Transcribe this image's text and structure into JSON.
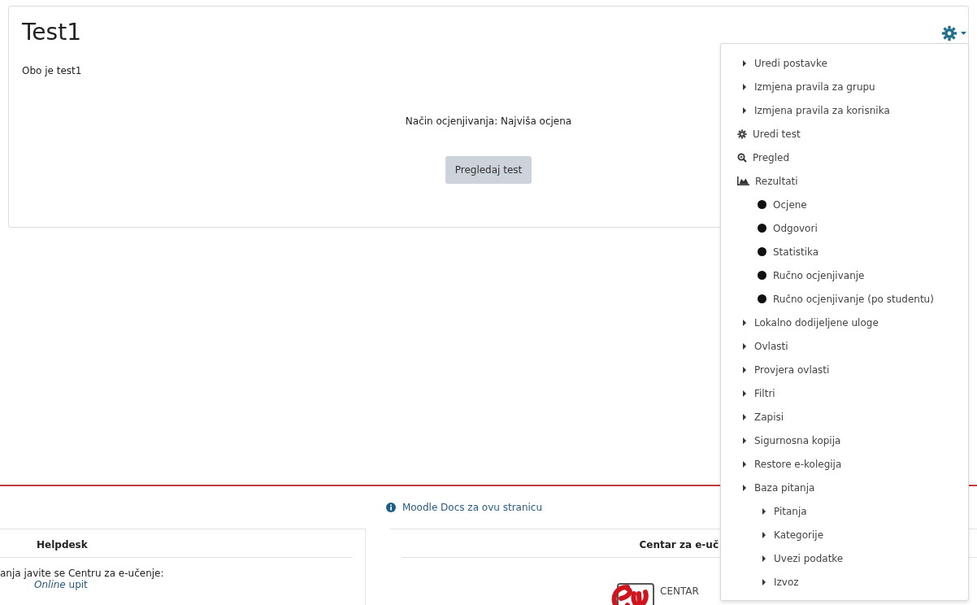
{
  "activity": {
    "title": "Test1",
    "description": "Obo je test1",
    "grading_method": "Način ocjenjivanja: Najviša ocjena",
    "preview_button": "Pregledaj test"
  },
  "settings_menu": {
    "expanded": true,
    "items": [
      {
        "kind": "arrow",
        "label": "Uredi postavke"
      },
      {
        "kind": "arrow",
        "label": "Izmjena pravila za grupu"
      },
      {
        "kind": "arrow",
        "label": "Izmjena pravila za korisnika"
      },
      {
        "kind": "gear",
        "label": "Uredi test"
      },
      {
        "kind": "search",
        "label": "Pregled"
      },
      {
        "kind": "chart",
        "label": "Rezultati",
        "children": [
          {
            "kind": "bullet",
            "label": "Ocjene"
          },
          {
            "kind": "bullet",
            "label": "Odgovori"
          },
          {
            "kind": "bullet",
            "label": "Statistika"
          },
          {
            "kind": "bullet",
            "label": "Ručno ocjenjivanje"
          },
          {
            "kind": "bullet",
            "label": "Ručno ocjenjivanje (po studentu)"
          }
        ]
      },
      {
        "kind": "arrow",
        "label": "Lokalno dodijeljene uloge"
      },
      {
        "kind": "arrow",
        "label": "Ovlasti"
      },
      {
        "kind": "arrow",
        "label": "Provjera ovlasti"
      },
      {
        "kind": "arrow",
        "label": "Filtri"
      },
      {
        "kind": "arrow",
        "label": "Zapisi"
      },
      {
        "kind": "arrow",
        "label": "Sigurnosna kopija"
      },
      {
        "kind": "arrow",
        "label": "Restore e-kolegija"
      },
      {
        "kind": "arrow",
        "label": "Baza pitanja",
        "children": [
          {
            "kind": "arrow",
            "label": "Pitanja"
          },
          {
            "kind": "arrow",
            "label": "Kategorije"
          },
          {
            "kind": "arrow",
            "label": "Uvezi podatke"
          },
          {
            "kind": "arrow",
            "label": "Izvoz"
          }
        ]
      }
    ]
  },
  "footer": {
    "docs_link": "Moodle Docs za ovu stranicu",
    "helpdesk": {
      "title": "Helpdesk",
      "text": "anja javite se Centru za e-učenje:",
      "link": "*Online* upit"
    },
    "center": {
      "title": "Centar za e-uč",
      "logo_text": "CENTAR"
    }
  }
}
